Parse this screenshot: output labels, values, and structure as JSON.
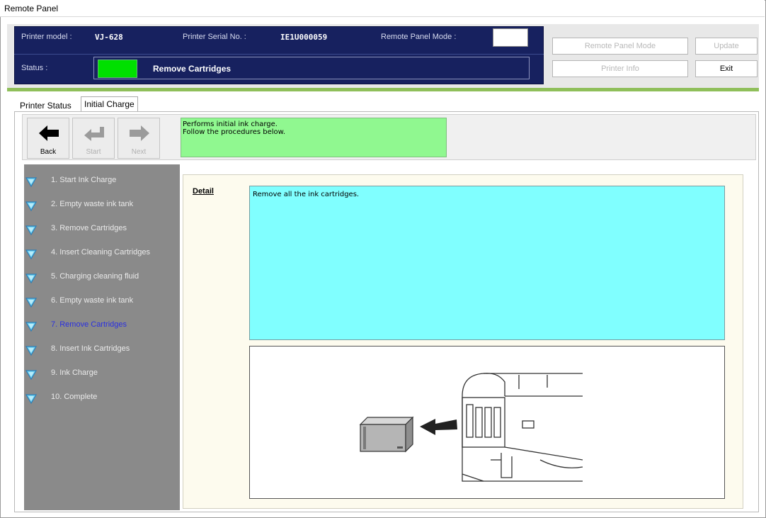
{
  "window": {
    "title": "Remote Panel"
  },
  "header": {
    "model_label": "Printer model :",
    "model_value": "VJ-628",
    "serial_label": "Printer Serial No. :",
    "serial_value": "IE1U000059",
    "mode_label": "Remote Panel Mode :",
    "status_label": "Status :",
    "status_text": "Remove Cartridges",
    "status_color": "#00e000",
    "accent_blue": "#17215f"
  },
  "buttons": {
    "remote_panel_mode": "Remote Panel Mode",
    "update": "Update",
    "printer_info": "Printer Info",
    "exit": "Exit"
  },
  "tabs": [
    {
      "label": "Printer Status"
    },
    {
      "label": "Initial Charge"
    }
  ],
  "toolbar": {
    "back": "Back",
    "start": "Start",
    "next": "Next",
    "message_line1": "Performs initial ink charge.",
    "message_line2": "Follow the procedures below."
  },
  "steps": [
    {
      "label": "1. Start Ink Charge"
    },
    {
      "label": "2. Empty waste ink tank"
    },
    {
      "label": "3. Remove Cartridges"
    },
    {
      "label": "4. Insert Cleaning Cartridges"
    },
    {
      "label": "5. Charging cleaning fluid"
    },
    {
      "label": "6. Empty waste ink tank"
    },
    {
      "label": "7. Remove Cartridges",
      "current": true
    },
    {
      "label": "8. Insert Ink Cartridges"
    },
    {
      "label": "9. Ink Charge"
    },
    {
      "label": "10. Complete"
    }
  ],
  "detail": {
    "label": "Detail",
    "text": "Remove all the ink cartridges.",
    "illustration": "remove-cartridge-illustration"
  }
}
